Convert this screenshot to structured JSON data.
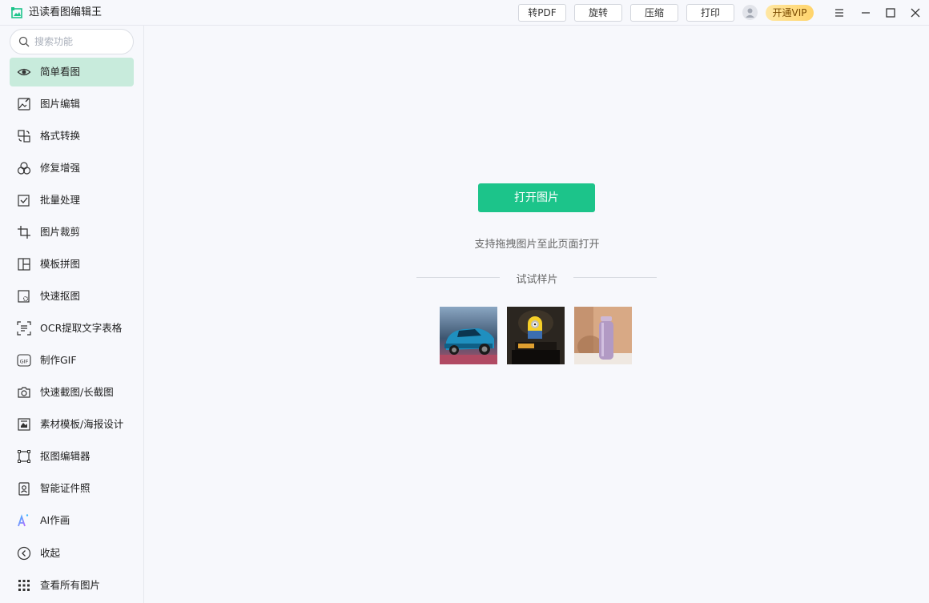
{
  "app": {
    "title": "迅读看图编辑王"
  },
  "toolbar": {
    "to_pdf": "转PDF",
    "rotate": "旋转",
    "compress": "压缩",
    "print": "打印",
    "vip": "开通VIP"
  },
  "colors": {
    "accent": "#1cc48a",
    "active_bg": "#c8ebdc",
    "vip": "#ffd46b"
  },
  "search": {
    "placeholder": "搜索功能"
  },
  "sidebar": {
    "items": [
      {
        "label": "简单看图",
        "icon": "eye-icon",
        "active": true
      },
      {
        "label": "图片编辑",
        "icon": "image-edit-icon"
      },
      {
        "label": "格式转换",
        "icon": "format-convert-icon"
      },
      {
        "label": "修复增强",
        "icon": "enhance-icon"
      },
      {
        "label": "批量处理",
        "icon": "batch-icon"
      },
      {
        "label": "图片裁剪",
        "icon": "crop-icon"
      },
      {
        "label": "模板拼图",
        "icon": "collage-icon"
      },
      {
        "label": "快速抠图",
        "icon": "cutout-icon"
      },
      {
        "label": "OCR提取文字表格",
        "icon": "ocr-icon"
      },
      {
        "label": "制作GIF",
        "icon": "gif-icon"
      },
      {
        "label": "快速截图/长截图",
        "icon": "camera-icon"
      },
      {
        "label": "素材模板/海报设计",
        "icon": "poster-icon"
      },
      {
        "label": "抠图编辑器",
        "icon": "cutout-editor-icon"
      },
      {
        "label": "智能证件照",
        "icon": "id-photo-icon"
      },
      {
        "label": "AI作画",
        "icon": "ai-paint-icon"
      },
      {
        "label": "收起",
        "icon": "collapse-icon"
      },
      {
        "label": "查看所有图片",
        "icon": "grid-icon"
      }
    ]
  },
  "main": {
    "open_button": "打开图片",
    "drag_hint": "支持拖拽图片至此页面打开",
    "samples_label": "试试样片"
  }
}
